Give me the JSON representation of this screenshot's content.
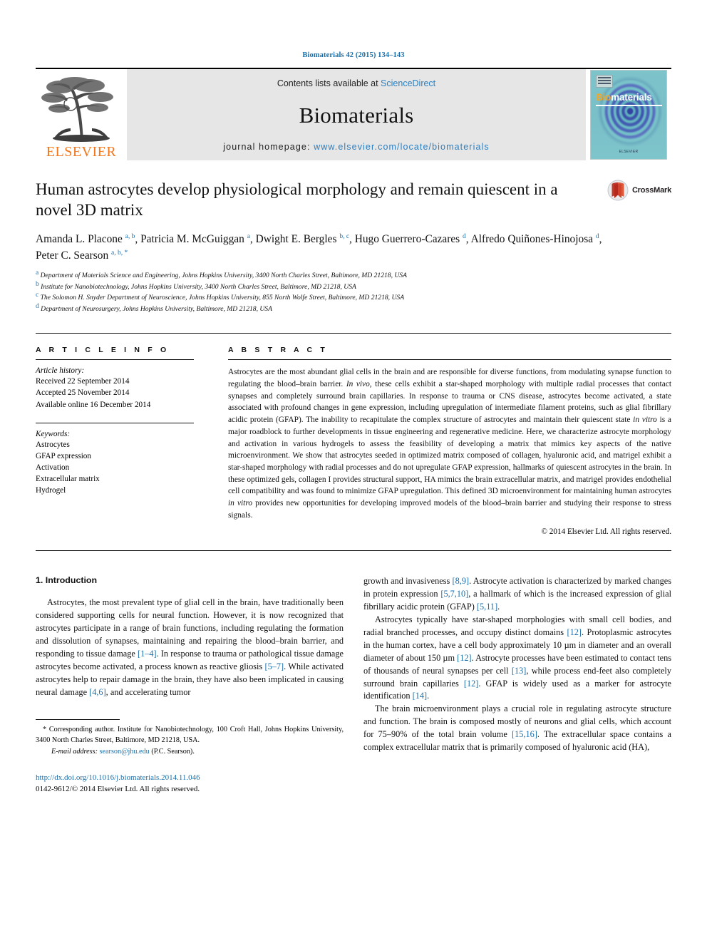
{
  "running_head": "Biomaterials 42 (2015) 134–143",
  "masthead": {
    "publisher_name": "ELSEVIER",
    "contents_prefix": "Contents lists available at ",
    "contents_link": "ScienceDirect",
    "journal_name": "Biomaterials",
    "homepage_prefix": "journal homepage: ",
    "homepage_url": "www.elsevier.com/locate/biomaterials",
    "cover": {
      "title_part1": "Bio",
      "title_part2": "materials",
      "footer": "ELSEVIER"
    }
  },
  "article": {
    "title": "Human astrocytes develop physiological morphology and remain quiescent in a novel 3D matrix",
    "crossmark_label": "CrossMark",
    "authors": [
      {
        "name": "Amanda L. Placone",
        "marks": "a, b",
        "sep": ", "
      },
      {
        "name": "Patricia M. McGuiggan",
        "marks": "a",
        "sep": ", "
      },
      {
        "name": "Dwight E. Bergles",
        "marks": "b, c",
        "sep": ", "
      },
      {
        "name": "Hugo Guerrero-Cazares",
        "marks": "d",
        "sep": ", "
      },
      {
        "name": "Alfredo Quiñones-Hinojosa",
        "marks": "d",
        "sep": ", "
      },
      {
        "name": "Peter C. Searson",
        "marks": "a, b, *",
        "sep": ""
      }
    ],
    "affiliations": [
      {
        "mark": "a",
        "text": "Department of Materials Science and Engineering, Johns Hopkins University, 3400 North Charles Street, Baltimore, MD 21218, USA"
      },
      {
        "mark": "b",
        "text": "Institute for Nanobiotechnology, Johns Hopkins University, 3400 North Charles Street, Baltimore, MD 21218, USA"
      },
      {
        "mark": "c",
        "text": "The Solomon H. Snyder Department of Neuroscience, Johns Hopkins University, 855 North Wolfe Street, Baltimore, MD 21218, USA"
      },
      {
        "mark": "d",
        "text": "Department of Neurosurgery, Johns Hopkins University, Baltimore, MD 21218, USA"
      }
    ]
  },
  "article_info": {
    "heading": "A R T I C L E   I N F O",
    "history_label": "Article history:",
    "history": [
      "Received 22 September 2014",
      "Accepted 25 November 2014",
      "Available online 16 December 2014"
    ],
    "keywords_label": "Keywords:",
    "keywords": [
      "Astrocytes",
      "GFAP expression",
      "Activation",
      "Extracellular matrix",
      "Hydrogel"
    ]
  },
  "abstract": {
    "heading": "A B S T R A C T",
    "paragraph_html": "Astrocytes are the most abundant glial cells in the brain and are responsible for diverse functions, from modulating synapse function to regulating the blood&#8211;brain barrier. <i>In vivo</i>, these cells exhibit a star-shaped morphology with multiple radial processes that contact synapses and completely surround brain capillaries. In response to trauma or CNS disease, astrocytes become activated, a state associated with profound changes in gene expression, including upregulation of intermediate filament proteins, such as glial fibrillary acidic protein (GFAP). The inability to recapitulate the complex structure of astrocytes and maintain their quiescent state <i>in vitro</i> is a major roadblock to further developments in tissue engineering and regenerative medicine. Here, we characterize astrocyte morphology and activation in various hydrogels to assess the feasibility of developing a matrix that mimics key aspects of the native microenvironment. We show that astrocytes seeded in optimized matrix composed of collagen, hyaluronic acid, and matrigel exhibit a star-shaped morphology with radial processes and do not upregulate GFAP expression, hallmarks of quiescent astrocytes in the brain. In these optimized gels, collagen I provides structural support, HA mimics the brain extracellular matrix, and matrigel provides endothelial cell compatibility and was found to minimize GFAP upregulation. This defined 3D microenvironment for maintaining human astrocytes <i>in vitro</i> provides new opportunities for developing improved models of the blood&#8211;brain barrier and studying their response to stress signals.",
    "copyright": "© 2014 Elsevier Ltd. All rights reserved."
  },
  "body": {
    "section_number_title": "1. Introduction",
    "left_paragraphs_html": [
      "Astrocytes, the most prevalent type of glial cell in the brain, have traditionally been considered supporting cells for neural function. However, it is now recognized that astrocytes participate in a range of brain functions, including regulating the formation and dissolution of synapses, maintaining and repairing the blood&#8211;brain barrier, and responding to tissue damage <span class=\"ref\">[1&#8211;4]</span>. In response to trauma or pathological tissue damage astrocytes become activated, a process known as reactive gliosis <span class=\"ref\">[5&#8211;7]</span>. While activated astrocytes help to repair damage in the brain, they have also been implicated in causing neural damage <span class=\"ref\">[4,6]</span>, and accelerating tumor"
    ],
    "right_paragraphs_html": [
      "growth and invasiveness <span class=\"ref\">[8,9]</span>. Astrocyte activation is characterized by marked changes in protein expression <span class=\"ref\">[5,7,10]</span>, a hallmark of which is the increased expression of glial fibrillary acidic protein (GFAP) <span class=\"ref\">[5,11]</span>.",
      "Astrocytes typically have star-shaped morphologies with small cell bodies, and radial branched processes, and occupy distinct domains <span class=\"ref\">[12]</span>. Protoplasmic astrocytes in the human cortex, have a cell body approximately 10 &#181;m in diameter and an overall diameter of about 150 &#181;m <span class=\"ref\">[12]</span>. Astrocyte processes have been estimated to contact tens of thousands of neural synapses per cell <span class=\"ref\">[13]</span>, while process end-feet also completely surround brain capillaries <span class=\"ref\">[12]</span>. GFAP is widely used as a marker for astrocyte identification <span class=\"ref\">[14]</span>.",
      "The brain microenvironment plays a crucial role in regulating astrocyte structure and function. The brain is composed mostly of neurons and glial cells, which account for 75&#8211;90% of the total brain volume <span class=\"ref\">[15,16]</span>. The extracellular space contains a complex extracellular matrix that is primarily composed of hyaluronic acid (HA),"
    ]
  },
  "footer": {
    "corresponding_html": "* Corresponding author. Institute for Nanobiotechnology, 100 Croft Hall, Johns Hopkins University, 3400 North Charles Street, Baltimore, MD 21218, USA.",
    "email_label": "E-mail address:",
    "email": "searson@jhu.edu",
    "email_suffix": "(P.C. Searson).",
    "doi": "http://dx.doi.org/10.1016/j.biomaterials.2014.11.046",
    "issn_line": "0142-9612/© 2014 Elsevier Ltd. All rights reserved."
  },
  "colors": {
    "link": "#1a6ea8",
    "elsevier_orange": "#F3761B",
    "masthead_bg": "#e6e6e6",
    "crossmark_red": "#C0392B"
  }
}
